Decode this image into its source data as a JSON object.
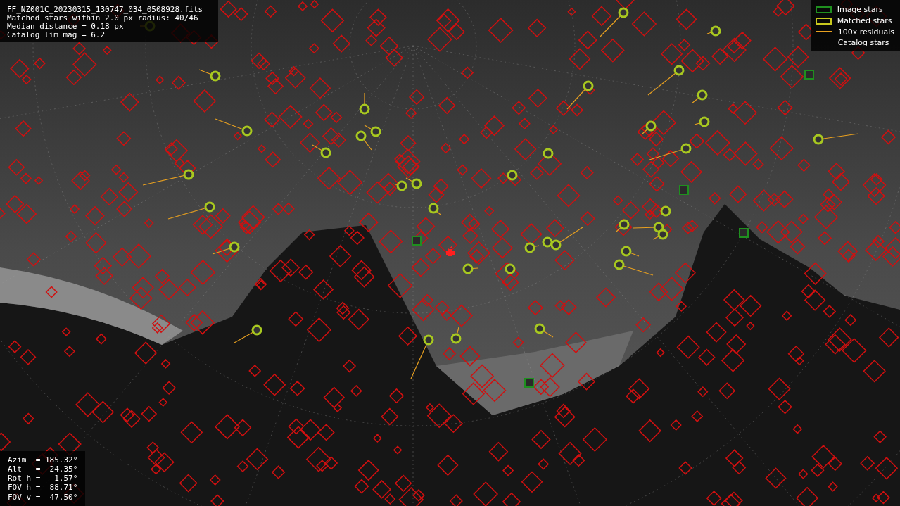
{
  "info": {
    "lines": [
      "FF_NZ001C_20230315_130747_034_0508928.fits",
      "Matched stars within 2.0 px radius: 40/46",
      "Median distance = 0.18 px",
      "Catalog lim mag = 6.2"
    ]
  },
  "legend": [
    {
      "label": "Image stars",
      "kind": "box",
      "color": "#1f8f1f"
    },
    {
      "label": "Matched stars",
      "kind": "box",
      "color": "#c8c81e"
    },
    {
      "label": "100x residuals",
      "kind": "line",
      "color": "#e8a020"
    },
    {
      "label": "Catalog stars",
      "kind": "blank"
    }
  ],
  "pointing": {
    "lines": [
      "Azim  = 185.32°",
      "Alt   =  24.35°",
      "Rot h =   1.57°",
      "FOV h =  88.71°",
      "FOV v =  47.50°"
    ]
  }
}
